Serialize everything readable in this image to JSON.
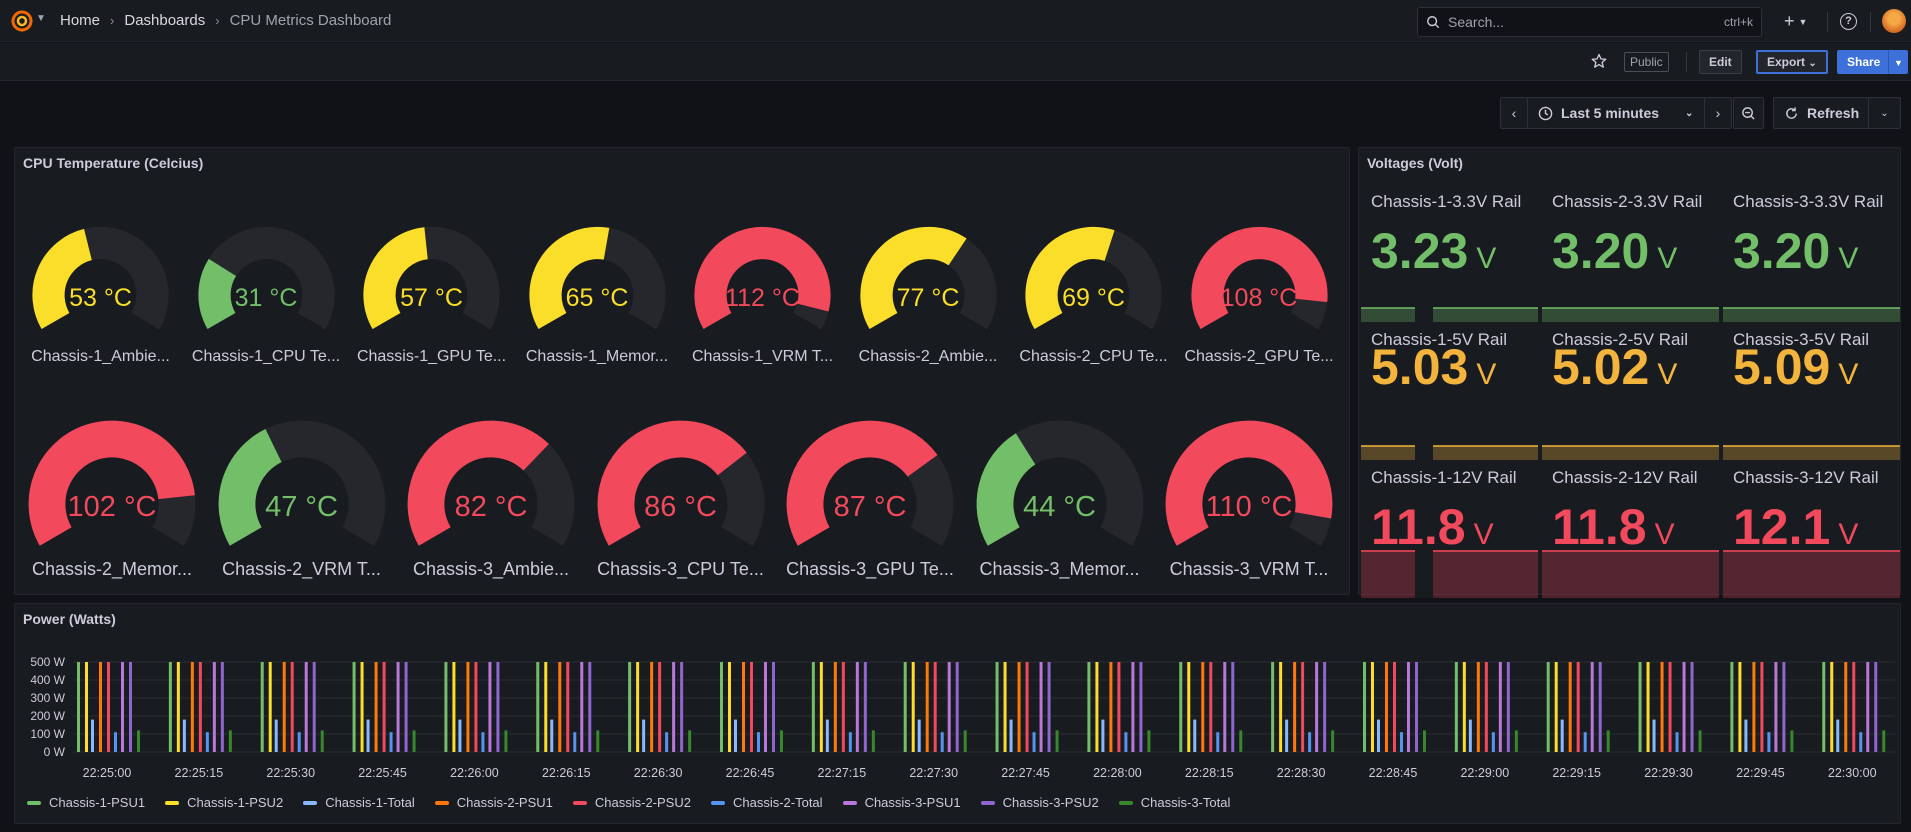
{
  "nav": {
    "breadcrumbs": [
      "Home",
      "Dashboards"
    ],
    "current": "CPU Metrics Dashboard",
    "search_placeholder": "Search...",
    "search_shortcut": "ctrl+k"
  },
  "toolbar": {
    "public_badge": "Public",
    "edit_label": "Edit",
    "export_label": "Export",
    "share_label": "Share"
  },
  "time": {
    "range_label": "Last 5 minutes",
    "refresh_label": "Refresh"
  },
  "colors": {
    "green": "#73bf69",
    "yellow": "#fade2a",
    "red": "#f2495c",
    "orange": "#f2b43c"
  },
  "temperature_panel": {
    "title": "CPU Temperature (Celcius)",
    "min": 0,
    "max": 120,
    "gauges": [
      {
        "label": "Chassis-1_Ambie...",
        "value": 53,
        "display": "53 °C",
        "status": "yellow"
      },
      {
        "label": "Chassis-1_CPU Te...",
        "value": 31,
        "display": "31 °C",
        "status": "green"
      },
      {
        "label": "Chassis-1_GPU Te...",
        "value": 57,
        "display": "57 °C",
        "status": "yellow"
      },
      {
        "label": "Chassis-1_Memor...",
        "value": 65,
        "display": "65 °C",
        "status": "yellow"
      },
      {
        "label": "Chassis-1_VRM T...",
        "value": 112,
        "display": "112 °C",
        "status": "red"
      },
      {
        "label": "Chassis-2_Ambie...",
        "value": 77,
        "display": "77 °C",
        "status": "yellow"
      },
      {
        "label": "Chassis-2_CPU Te...",
        "value": 69,
        "display": "69 °C",
        "status": "yellow"
      },
      {
        "label": "Chassis-2_GPU Te...",
        "value": 108,
        "display": "108 °C",
        "status": "red"
      },
      {
        "label": "Chassis-2_Memor...",
        "value": 102,
        "display": "102 °C",
        "status": "red"
      },
      {
        "label": "Chassis-2_VRM T...",
        "value": 47,
        "display": "47 °C",
        "status": "green"
      },
      {
        "label": "Chassis-3_Ambie...",
        "value": 82,
        "display": "82 °C",
        "status": "red"
      },
      {
        "label": "Chassis-3_CPU Te...",
        "value": 86,
        "display": "86 °C",
        "status": "red"
      },
      {
        "label": "Chassis-3_GPU Te...",
        "value": 87,
        "display": "87 °C",
        "status": "red"
      },
      {
        "label": "Chassis-3_Memor...",
        "value": 44,
        "display": "44 °C",
        "status": "green"
      },
      {
        "label": "Chassis-3_VRM T...",
        "value": 110,
        "display": "110 °C",
        "status": "red"
      }
    ]
  },
  "voltage_panel": {
    "title": "Voltages (Volt)",
    "unit": "V",
    "stats": [
      {
        "label": "Chassis-1-3.3V Rail",
        "value": "3.23",
        "status": "green"
      },
      {
        "label": "Chassis-2-3.3V Rail",
        "value": "3.20",
        "status": "green"
      },
      {
        "label": "Chassis-3-3.3V Rail",
        "value": "3.20",
        "status": "green"
      },
      {
        "label": "Chassis-1-5V Rail",
        "value": "5.03",
        "status": "orange"
      },
      {
        "label": "Chassis-2-5V Rail",
        "value": "5.02",
        "status": "orange"
      },
      {
        "label": "Chassis-3-5V Rail",
        "value": "5.09",
        "status": "orange"
      },
      {
        "label": "Chassis-1-12V Rail",
        "value": "11.8",
        "status": "red"
      },
      {
        "label": "Chassis-2-12V Rail",
        "value": "11.8",
        "status": "red"
      },
      {
        "label": "Chassis-3-12V Rail",
        "value": "12.1",
        "status": "red"
      }
    ]
  },
  "chart_data": {
    "type": "bar",
    "title": "Power (Watts)",
    "ylim": [
      0,
      500
    ],
    "yticks": [
      "500 W",
      "400 W",
      "300 W",
      "200 W",
      "100 W",
      "0 W"
    ],
    "xticks": [
      "22:25:00",
      "22:25:15",
      "22:25:30",
      "22:25:45",
      "22:26:00",
      "22:26:15",
      "22:26:30",
      "22:26:45",
      "22:27:15",
      "22:27:30",
      "22:27:45",
      "22:28:00",
      "22:28:15",
      "22:28:30",
      "22:28:45",
      "22:29:00",
      "22:29:15",
      "22:29:30",
      "22:29:45",
      "22:30:00"
    ],
    "grid": true,
    "legend_position": "bottom",
    "series": [
      {
        "name": "Chassis-1-PSU1",
        "color": "#73bf69",
        "value": 500
      },
      {
        "name": "Chassis-1-PSU2",
        "color": "#fade2a",
        "value": 500
      },
      {
        "name": "Chassis-1-Total",
        "color": "#8ab8ff",
        "value": 180
      },
      {
        "name": "Chassis-2-PSU1",
        "color": "#ff780a",
        "value": 500
      },
      {
        "name": "Chassis-2-PSU2",
        "color": "#f2495c",
        "value": 500
      },
      {
        "name": "Chassis-2-Total",
        "color": "#5794f2",
        "value": 110
      },
      {
        "name": "Chassis-3-PSU1",
        "color": "#b877d9",
        "value": 500
      },
      {
        "name": "Chassis-3-PSU2",
        "color": "#8f66cf",
        "value": 500
      },
      {
        "name": "Chassis-3-Total",
        "color": "#37872d",
        "value": 120
      }
    ]
  }
}
